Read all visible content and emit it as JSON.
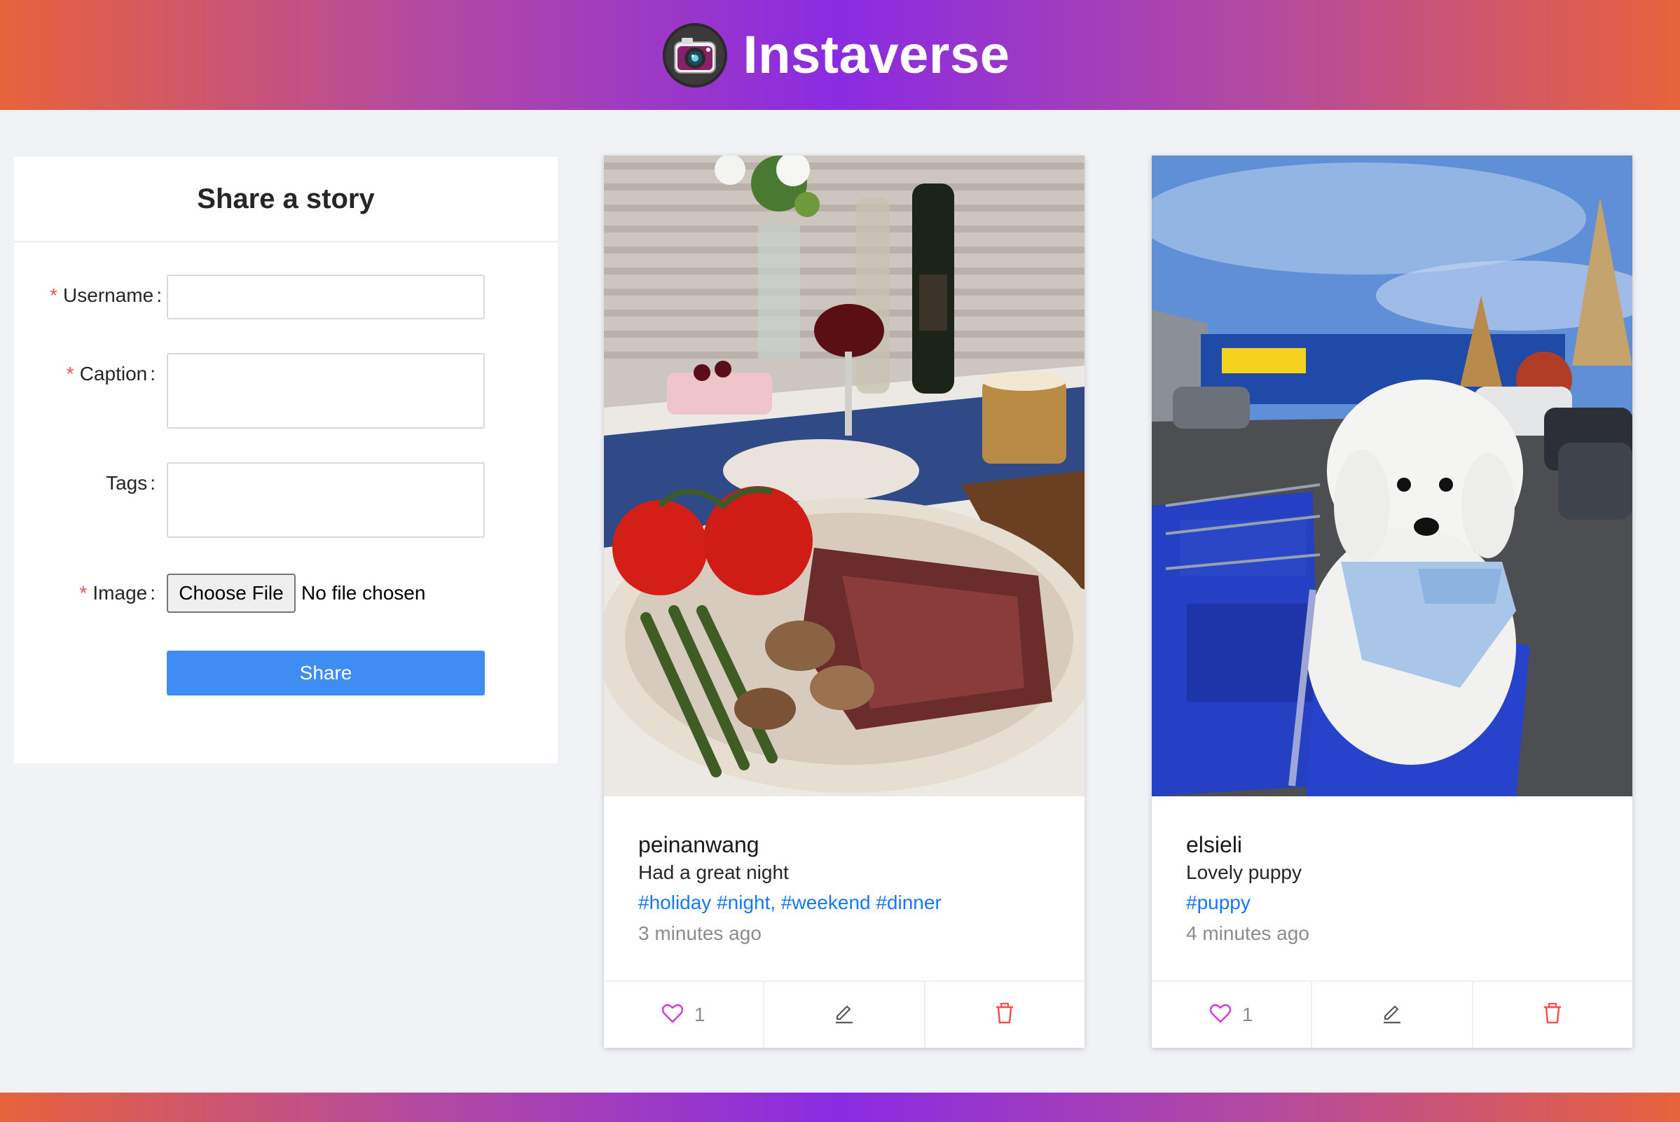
{
  "header": {
    "logo_icon": "camera-icon",
    "title": "Instaverse"
  },
  "form": {
    "title": "Share a story",
    "username": {
      "label": "Username",
      "required": true,
      "value": ""
    },
    "caption": {
      "label": "Caption",
      "required": true,
      "value": ""
    },
    "tags": {
      "label": "Tags",
      "required": false,
      "value": ""
    },
    "image": {
      "label": "Image",
      "required": true,
      "button_label": "Choose File",
      "status": "No file chosen"
    },
    "share_label": "Share",
    "colon": ":",
    "required_mark": "*"
  },
  "posts": [
    {
      "username": "peinanwang",
      "caption": "Had a great night",
      "tags": "#holiday #night, #weekend #dinner",
      "time": "3 minutes ago",
      "likes": "1",
      "image_subject": "steak-dinner-photo"
    },
    {
      "username": "elsieli",
      "caption": "Lovely puppy",
      "tags": "#puppy",
      "time": "4 minutes ago",
      "likes": "1",
      "image_subject": "puppy-in-cart-photo"
    }
  ],
  "icons": {
    "like": "heart-icon",
    "edit": "edit-icon",
    "delete": "trash-icon"
  },
  "colors": {
    "header_gradient_edge": "#e8623b",
    "header_gradient_center": "#8a2be2",
    "share_button": "#3f8cf3",
    "tag_link": "#1677ff",
    "like_icon": "#d63bd8",
    "delete_icon": "#ff4d4f",
    "required_mark": "#ff4d4f"
  }
}
